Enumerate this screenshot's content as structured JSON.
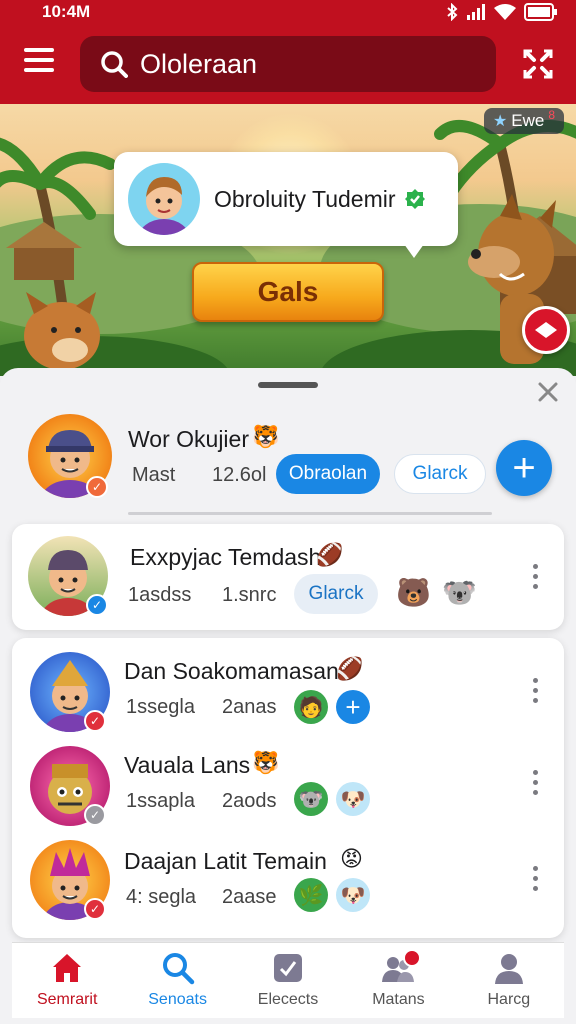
{
  "status_bar": {
    "time": "10:4M"
  },
  "search": {
    "value": "Ololeraan"
  },
  "banner": {
    "badge_text": "Ewe",
    "badge_mark": "8",
    "profile_name": "Obroluity Tudemir",
    "goals_label": "Gals"
  },
  "me": {
    "name": "Wor Okujier",
    "stat1": "Mast",
    "stat2": "12.6ol",
    "btn_primary": "Obraolan",
    "btn_secondary": "Glarck"
  },
  "highlight": {
    "name": "Exxpyjac Temdash",
    "stat1": "1asdss",
    "stat2": "1.snrc",
    "btn": "Glarck"
  },
  "list": [
    {
      "name": "Dan Soakomamasan",
      "stat1": "1ssegla",
      "stat2": "2anas"
    },
    {
      "name": "Vauala Lans",
      "stat1": "1ssapla",
      "stat2": "2aods"
    },
    {
      "name": "Daajan Latit Temain",
      "stat1": "4: segla",
      "stat2": "2aase"
    }
  ],
  "nav": [
    {
      "label": "Semrarit"
    },
    {
      "label": "Senoats"
    },
    {
      "label": "Elecects"
    },
    {
      "label": "Matans"
    },
    {
      "label": "Harcg"
    }
  ],
  "colors": {
    "brand": "#c0101f",
    "accent": "#1a87e4",
    "verified": "#e0303c"
  }
}
